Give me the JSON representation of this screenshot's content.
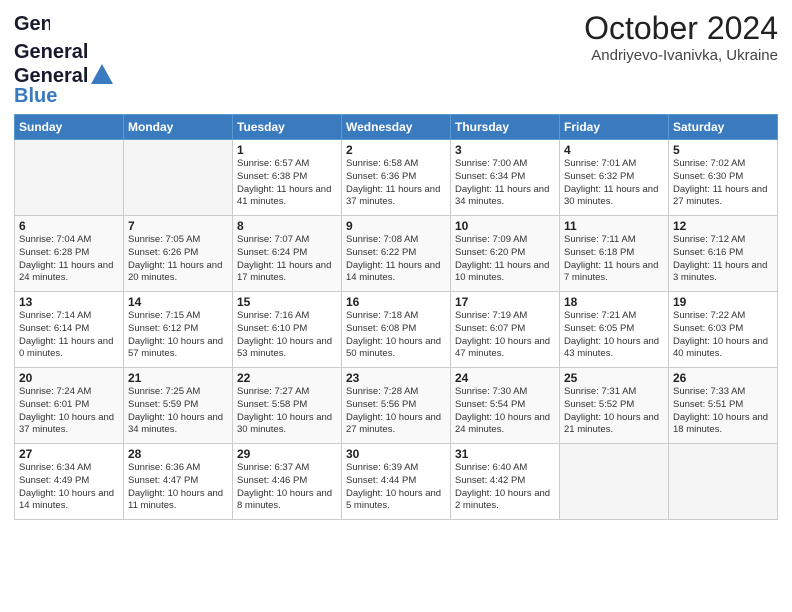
{
  "header": {
    "logo_line1": "General",
    "logo_line2": "Blue",
    "month": "October 2024",
    "location": "Andriyevo-Ivanivka, Ukraine"
  },
  "weekdays": [
    "Sunday",
    "Monday",
    "Tuesday",
    "Wednesday",
    "Thursday",
    "Friday",
    "Saturday"
  ],
  "weeks": [
    [
      {
        "day": "",
        "info": ""
      },
      {
        "day": "",
        "info": ""
      },
      {
        "day": "1",
        "info": "Sunrise: 6:57 AM\nSunset: 6:38 PM\nDaylight: 11 hours and 41 minutes."
      },
      {
        "day": "2",
        "info": "Sunrise: 6:58 AM\nSunset: 6:36 PM\nDaylight: 11 hours and 37 minutes."
      },
      {
        "day": "3",
        "info": "Sunrise: 7:00 AM\nSunset: 6:34 PM\nDaylight: 11 hours and 34 minutes."
      },
      {
        "day": "4",
        "info": "Sunrise: 7:01 AM\nSunset: 6:32 PM\nDaylight: 11 hours and 30 minutes."
      },
      {
        "day": "5",
        "info": "Sunrise: 7:02 AM\nSunset: 6:30 PM\nDaylight: 11 hours and 27 minutes."
      }
    ],
    [
      {
        "day": "6",
        "info": "Sunrise: 7:04 AM\nSunset: 6:28 PM\nDaylight: 11 hours and 24 minutes."
      },
      {
        "day": "7",
        "info": "Sunrise: 7:05 AM\nSunset: 6:26 PM\nDaylight: 11 hours and 20 minutes."
      },
      {
        "day": "8",
        "info": "Sunrise: 7:07 AM\nSunset: 6:24 PM\nDaylight: 11 hours and 17 minutes."
      },
      {
        "day": "9",
        "info": "Sunrise: 7:08 AM\nSunset: 6:22 PM\nDaylight: 11 hours and 14 minutes."
      },
      {
        "day": "10",
        "info": "Sunrise: 7:09 AM\nSunset: 6:20 PM\nDaylight: 11 hours and 10 minutes."
      },
      {
        "day": "11",
        "info": "Sunrise: 7:11 AM\nSunset: 6:18 PM\nDaylight: 11 hours and 7 minutes."
      },
      {
        "day": "12",
        "info": "Sunrise: 7:12 AM\nSunset: 6:16 PM\nDaylight: 11 hours and 3 minutes."
      }
    ],
    [
      {
        "day": "13",
        "info": "Sunrise: 7:14 AM\nSunset: 6:14 PM\nDaylight: 11 hours and 0 minutes."
      },
      {
        "day": "14",
        "info": "Sunrise: 7:15 AM\nSunset: 6:12 PM\nDaylight: 10 hours and 57 minutes."
      },
      {
        "day": "15",
        "info": "Sunrise: 7:16 AM\nSunset: 6:10 PM\nDaylight: 10 hours and 53 minutes."
      },
      {
        "day": "16",
        "info": "Sunrise: 7:18 AM\nSunset: 6:08 PM\nDaylight: 10 hours and 50 minutes."
      },
      {
        "day": "17",
        "info": "Sunrise: 7:19 AM\nSunset: 6:07 PM\nDaylight: 10 hours and 47 minutes."
      },
      {
        "day": "18",
        "info": "Sunrise: 7:21 AM\nSunset: 6:05 PM\nDaylight: 10 hours and 43 minutes."
      },
      {
        "day": "19",
        "info": "Sunrise: 7:22 AM\nSunset: 6:03 PM\nDaylight: 10 hours and 40 minutes."
      }
    ],
    [
      {
        "day": "20",
        "info": "Sunrise: 7:24 AM\nSunset: 6:01 PM\nDaylight: 10 hours and 37 minutes."
      },
      {
        "day": "21",
        "info": "Sunrise: 7:25 AM\nSunset: 5:59 PM\nDaylight: 10 hours and 34 minutes."
      },
      {
        "day": "22",
        "info": "Sunrise: 7:27 AM\nSunset: 5:58 PM\nDaylight: 10 hours and 30 minutes."
      },
      {
        "day": "23",
        "info": "Sunrise: 7:28 AM\nSunset: 5:56 PM\nDaylight: 10 hours and 27 minutes."
      },
      {
        "day": "24",
        "info": "Sunrise: 7:30 AM\nSunset: 5:54 PM\nDaylight: 10 hours and 24 minutes."
      },
      {
        "day": "25",
        "info": "Sunrise: 7:31 AM\nSunset: 5:52 PM\nDaylight: 10 hours and 21 minutes."
      },
      {
        "day": "26",
        "info": "Sunrise: 7:33 AM\nSunset: 5:51 PM\nDaylight: 10 hours and 18 minutes."
      }
    ],
    [
      {
        "day": "27",
        "info": "Sunrise: 6:34 AM\nSunset: 4:49 PM\nDaylight: 10 hours and 14 minutes."
      },
      {
        "day": "28",
        "info": "Sunrise: 6:36 AM\nSunset: 4:47 PM\nDaylight: 10 hours and 11 minutes."
      },
      {
        "day": "29",
        "info": "Sunrise: 6:37 AM\nSunset: 4:46 PM\nDaylight: 10 hours and 8 minutes."
      },
      {
        "day": "30",
        "info": "Sunrise: 6:39 AM\nSunset: 4:44 PM\nDaylight: 10 hours and 5 minutes."
      },
      {
        "day": "31",
        "info": "Sunrise: 6:40 AM\nSunset: 4:42 PM\nDaylight: 10 hours and 2 minutes."
      },
      {
        "day": "",
        "info": ""
      },
      {
        "day": "",
        "info": ""
      }
    ]
  ]
}
